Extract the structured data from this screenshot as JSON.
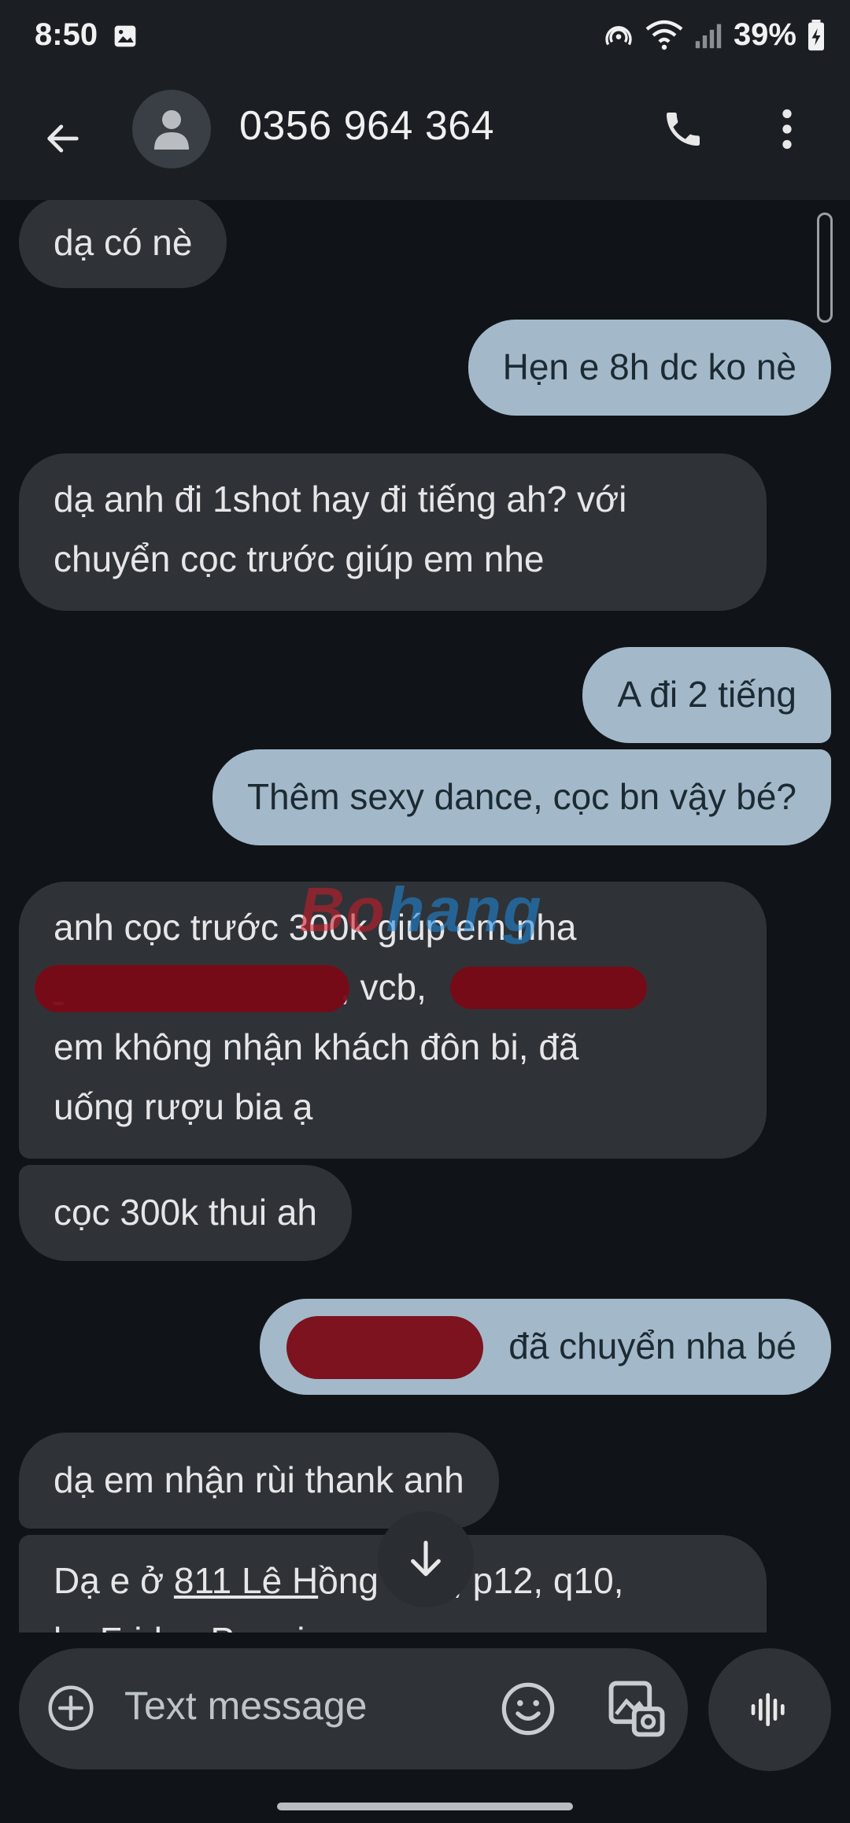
{
  "status": {
    "time": "8:50",
    "battery": "39%"
  },
  "header": {
    "contact": "0356 964 364"
  },
  "messages": {
    "m1": "dạ có nè",
    "m2": "Hẹn e 8h dc ko nè",
    "m3a": "dạ anh đi 1shot hay đi tiếng ah? với",
    "m3b": "chuyển cọc trước giúp em nhe",
    "m4": "A đi 2 tiếng",
    "m5": "Thêm sexy dance, cọc bn vậy bé?",
    "m6a": "anh cọc trước 300k giúp em nha",
    "m6b_suffix": ", vcb,",
    "m6c": "em không nhận khách đôn bi, đã",
    "m6d": "uống rượu bia ạ",
    "m7": "cọc 300k thui ah",
    "m8_suffix": "đã chuyển nha bé",
    "m9": "dạ em nhận rùi thank anh",
    "m10_prefix": "Dạ e ở ",
    "m10_link": "811 Lê H",
    "m10_rest": "ồng     ơng, p12, q10,",
    "m10b": "ks Friday Premium"
  },
  "watermark": {
    "part1": "Bo",
    "part2": "hang"
  },
  "composer": {
    "placeholder": "Text message"
  },
  "colors": {
    "background": "#101418",
    "incoming": "#2f3337",
    "outgoing": "#a3b9c9",
    "redaction": "#7a0a16"
  }
}
